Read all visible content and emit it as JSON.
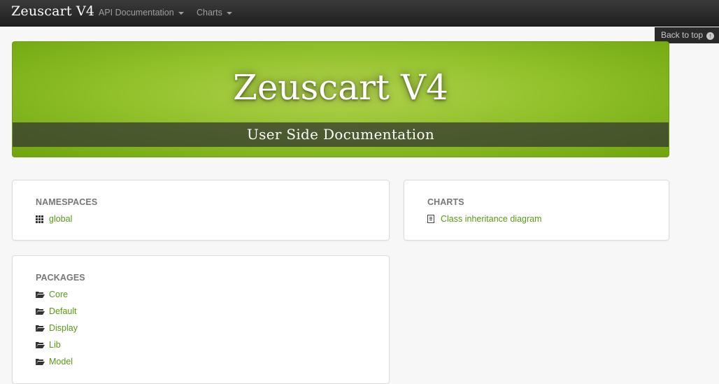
{
  "navbar": {
    "brand": "Zeuscart V4",
    "menu": [
      {
        "label": "API Documentation"
      },
      {
        "label": "Charts"
      }
    ]
  },
  "back_to_top": {
    "label": "Back to top"
  },
  "hero": {
    "title": "Zeuscart V4",
    "subtitle": "User Side Documentation",
    "color": "#93c22d"
  },
  "namespaces": {
    "heading": "NAMESPACES",
    "items": [
      {
        "label": "global",
        "icon": "grid-icon"
      }
    ]
  },
  "charts": {
    "heading": "CHARTS",
    "items": [
      {
        "label": "Class inheritance diagram",
        "icon": "list-icon"
      }
    ]
  },
  "packages": {
    "heading": "PACKAGES",
    "items": [
      {
        "label": "Core",
        "icon": "folder-icon"
      },
      {
        "label": "Default",
        "icon": "folder-icon"
      },
      {
        "label": "Display",
        "icon": "folder-icon"
      },
      {
        "label": "Lib",
        "icon": "folder-icon"
      },
      {
        "label": "Model",
        "icon": "folder-icon"
      }
    ]
  },
  "colors": {
    "link": "#5a9a14",
    "navbar": "#272727"
  }
}
